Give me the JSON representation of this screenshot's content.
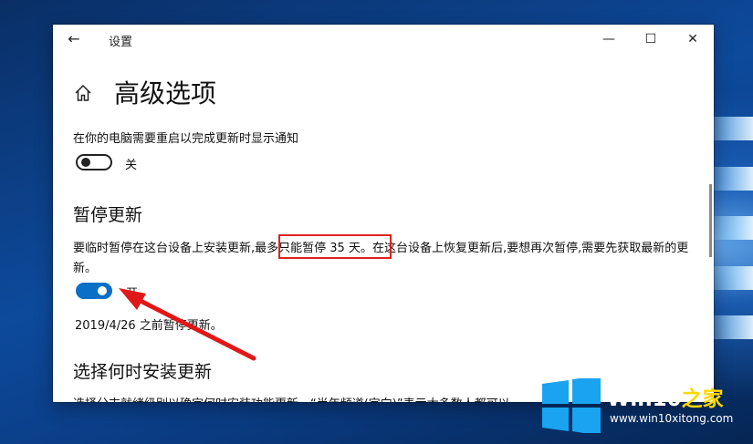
{
  "window": {
    "title": "设置",
    "minimize_glyph": "—",
    "maximize_glyph": "☐",
    "close_glyph": "✕",
    "back_glyph": "←"
  },
  "page": {
    "title": "高级选项"
  },
  "restart_notify": {
    "description": "在你的电脑需要重启以完成更新时显示通知",
    "toggle_state": "关"
  },
  "pause_updates": {
    "heading": "暂停更新",
    "description_before": "要临时暂停在这台设备上安装更新,",
    "description_highlight": "最多只能暂停 35 天",
    "description_after": "。在这台设备上恢复更新后,要想再次暂停,需要先获取最新的更新。",
    "toggle_state": "开",
    "pause_until": "2019/4/26 之前暂停更新。"
  },
  "install_time": {
    "heading": "选择何时安装更新",
    "description_partial": "选择分支就绪级别以确定何时安装功能更新。“半年频道(定向)”表示大多数人都可以"
  },
  "annotation": {
    "highlight_color": "#e02020"
  },
  "watermark": {
    "brand_part1": "Win10",
    "brand_part2": "之家",
    "url": "www.win10xitong.com"
  },
  "colors": {
    "accent": "#0a6fc7",
    "window_bg": "#ffffff"
  }
}
